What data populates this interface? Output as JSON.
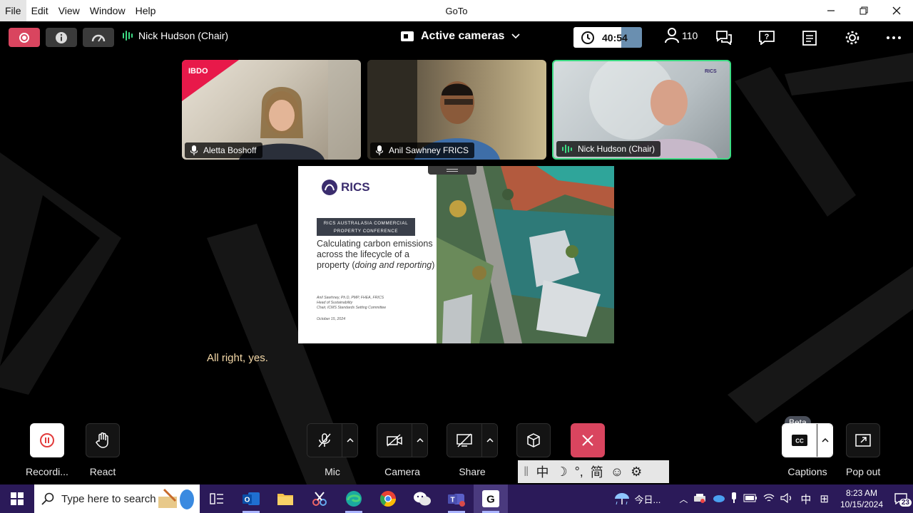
{
  "menubar": {
    "items": [
      "File",
      "Edit",
      "View",
      "Window",
      "Help"
    ],
    "title": "GoTo"
  },
  "toolbar": {
    "speaker_name": "Nick Hudson (Chair)",
    "layout_label": "Active cameras",
    "timer": "40:54",
    "attendee_count": "110"
  },
  "participants": [
    {
      "name": "Aletta Boshoff",
      "mic": "mic-icon"
    },
    {
      "name": "Anil Sawhney FRICS",
      "mic": "mic-icon"
    },
    {
      "name": "Nick Hudson (Chair)",
      "mic": "audio-level-icon"
    }
  ],
  "tile_logos": {
    "ibdo": "IBDO",
    "rics_small": "RICS"
  },
  "slide": {
    "logo": "RICS",
    "conference_line1": "RICS AUSTRALASIA COMMERCIAL",
    "conference_line2": "PROPERTY CONFERENCE",
    "title_main": "Calculating carbon emissions across the lifecycle of a property (",
    "title_italic": "doing and reporting",
    "title_end": ")",
    "author_line1": "Anil Sawhney, Ph.D, PMP, FHEA, FRICS",
    "author_line2": "Head of Sustainability",
    "author_line3": "Chair, ICMS Standards Setting Committee",
    "date": "October 15, 2024"
  },
  "caption_text": "All right, yes.",
  "controls": {
    "recording": "Recordi...",
    "react": "React",
    "mic": "Mic",
    "camera": "Camera",
    "share": "Share",
    "captions": "Captions",
    "captions_badge": "Beta",
    "popout": "Pop out"
  },
  "ime_bar": {
    "chars": [
      "中",
      "简"
    ]
  },
  "taskbar": {
    "search_placeholder": "Type here to search",
    "weather_text": "今日...",
    "ime_lang": "中",
    "time": "8:23 AM",
    "date": "10/15/2024",
    "notifications": "23"
  }
}
